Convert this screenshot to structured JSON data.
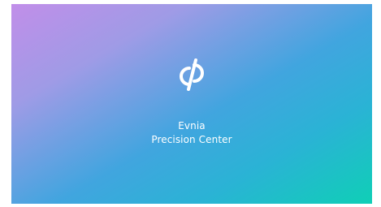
{
  "splash": {
    "logo_icon": "evnia-logo-icon",
    "title_line1": "Evnia",
    "title_line2": "Precision Center",
    "text_color": "#ffffff",
    "gradient_colors": [
      "#c18ee9",
      "#41a5df",
      "#0fcfb6"
    ]
  }
}
